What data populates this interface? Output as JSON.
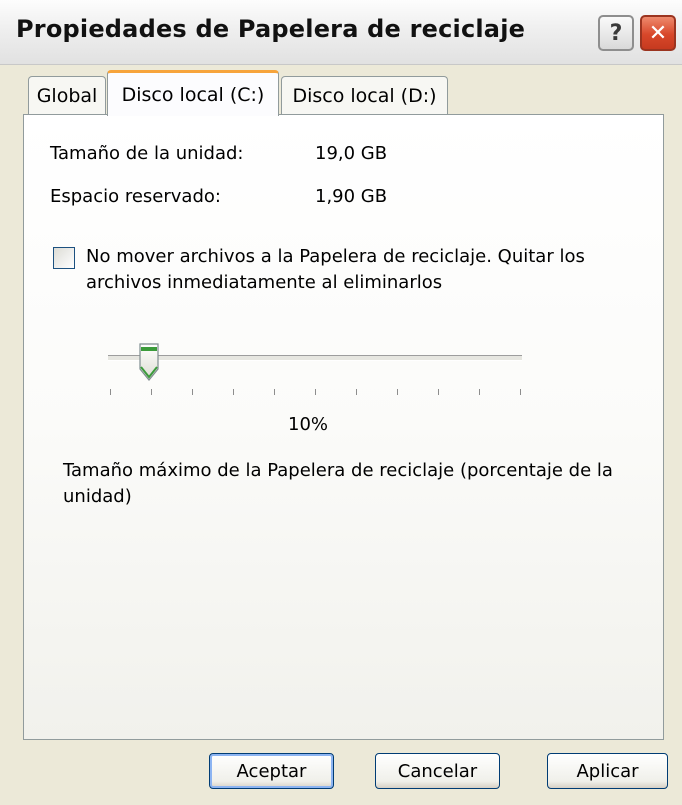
{
  "window": {
    "title": "Propiedades de Papelera de reciclaje"
  },
  "titlebar": {
    "help_label": "?",
    "close_label": "✕"
  },
  "tabs": [
    {
      "label": "Global",
      "selected": false
    },
    {
      "label": "Disco local (C:)",
      "selected": true
    },
    {
      "label": "Disco local (D:)",
      "selected": false
    }
  ],
  "drive_info": {
    "size_label": "Tamaño de la unidad:",
    "size_value": "19,0 GB",
    "reserved_label": "Espacio reservado:",
    "reserved_value": "1,90 GB"
  },
  "checkbox": {
    "label": "No mover archivos a la Papelera de reciclaje. Quitar los archivos inmediatamente al eliminarlos",
    "checked": false
  },
  "slider": {
    "value_percent": 10,
    "value_label": "10%",
    "tick_count": 11
  },
  "description": "Tamaño máximo de la Papelera de reciclaje (porcentaje de la unidad)",
  "buttons": {
    "ok": "Aceptar",
    "cancel": "Cancelar",
    "apply": "Aplicar"
  }
}
